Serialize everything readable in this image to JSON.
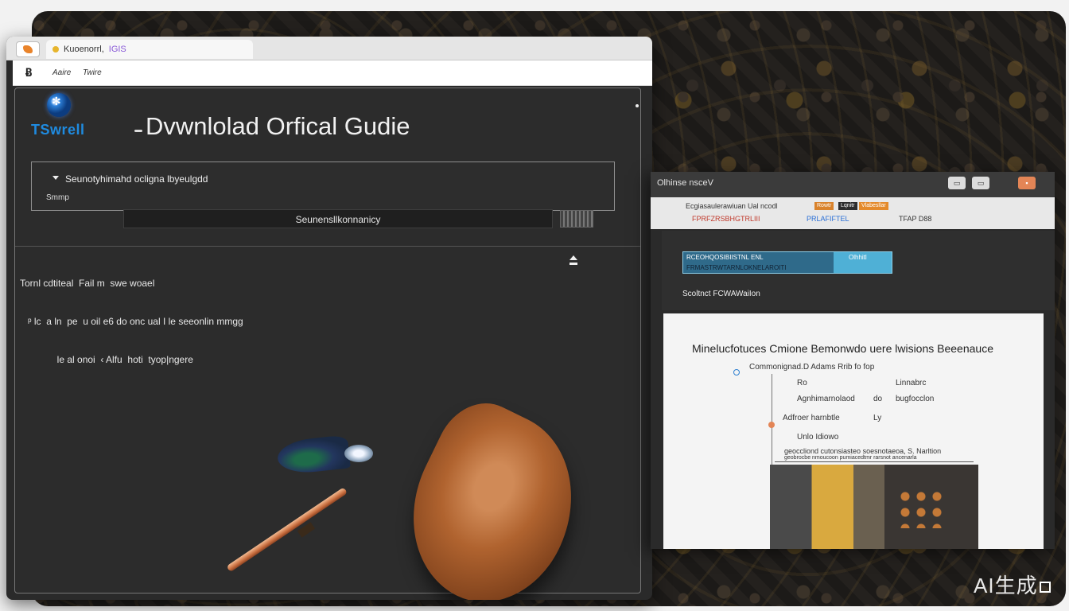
{
  "browser": {
    "tab_title": "Kuoenorrl,",
    "tab_extra": "IGIS",
    "menubar": {
      "logo": "Ƀ",
      "items": [
        "Aaire",
        "Twire"
      ]
    }
  },
  "page": {
    "brand": "TSwrell",
    "title": "Dvwnlolad Orfical Gudie",
    "select": {
      "text": "Seunotyhimahd ocligna lbyeulgdd",
      "sub": "Smmp"
    },
    "summary_label": "Seunensllkonnanicy",
    "description": [
      "Tornl cdtiteal  Fail m  swe woael",
      "   ᵖ lc  a ln  pe  u oil e6 do onc ual I le seeonlin mmgg",
      "              le al onoi  ‹ Alfu  hoti  tyop|ngere"
    ]
  },
  "side_window": {
    "title": "Olhinse nsceV",
    "buttons": [
      "▭",
      "▭",
      "▪"
    ],
    "toolbar_row1": "Ecgiasaulerawiuan  Ual   ncodl",
    "toolbar_badges": [
      {
        "text": "Rowtr",
        "color": "#d9822b"
      },
      {
        "text": "Lqnitr",
        "color": "#2d2d2d"
      },
      {
        "text": "Vlabesllar",
        "color": "#e48a2b"
      }
    ],
    "toolbar_row2": "FPRFZRSBHGTRLIII",
    "toolbar_row2_extra": "PRLAFIFTEL",
    "toolbar_right": "TFAP D88",
    "progress": {
      "line1": "RCEOHQOSIBIISTNL   ENL",
      "line1_extra": "Olhhitl",
      "line2": "FRMASTRWTARNLOKNELAROITI",
      "fraction": 0.72
    },
    "section_label": "Scoltnct FCWAWaiIon",
    "doc": {
      "title": "Minelucfotuces  Cmione Bemonwdo uere lwisions Beeenauce",
      "lines": [
        "Commonignad.D Adams  Rrib fo fop",
        "Ro",
        "Linnabrc",
        "Agnhimarnolaod",
        "do",
        "bugfocclon",
        "Adfroer harnbtle",
        "Ly",
        "Unlo   Idiowo",
        "geoccliond cutonsiasteo soesnotaeoa, S. Narltion",
        "geobrocbe nmoucoon pumiacedtmr rarsnot ancenarla"
      ]
    }
  },
  "watermark": "AI生成",
  "colors": {
    "accent_blue": "#1f8be0",
    "accent_orange": "#e38556",
    "progress_cyan": "#4fb0d6"
  },
  "icons": {
    "app": "app-icon",
    "download": "download-icon",
    "globe": "globe-icon",
    "expand": "chevron-down-icon"
  }
}
